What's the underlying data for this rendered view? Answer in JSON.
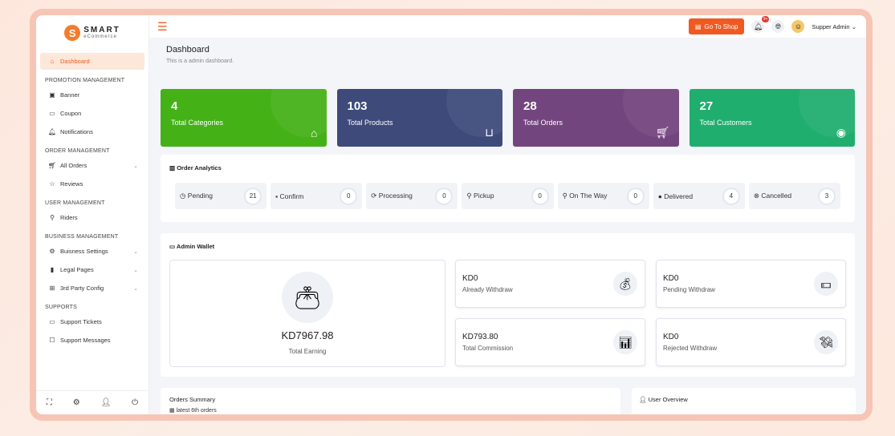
{
  "brand": {
    "name": "SMART",
    "tagline": "eCommerce",
    "mark": "S"
  },
  "sidebar": {
    "dashboard": "Dashboard",
    "sections": [
      {
        "heading": "PROMOTION MANAGEMENT",
        "items": [
          {
            "label": "Banner",
            "icon": "image-icon"
          },
          {
            "label": "Coupon",
            "icon": "ticket-icon"
          },
          {
            "label": "Notifications",
            "icon": "bell-icon"
          }
        ]
      },
      {
        "heading": "ORDER MANAGEMENT",
        "items": [
          {
            "label": "All Orders",
            "icon": "cart-icon"
          },
          {
            "label": "Reviews",
            "icon": "star-icon"
          }
        ]
      },
      {
        "heading": "USER MANAGEMENT",
        "items": [
          {
            "label": "Riders",
            "icon": "bike-icon"
          }
        ]
      },
      {
        "heading": "BUSINESS MANAGEMENT",
        "items": [
          {
            "label": "Buisness Settings",
            "icon": "gear-icon"
          },
          {
            "label": "Legal Pages",
            "icon": "bookmark-icon"
          },
          {
            "label": "3rd Party Config",
            "icon": "sitemap-icon"
          }
        ]
      },
      {
        "heading": "SUPPORTS",
        "items": [
          {
            "label": "Support Tickets",
            "icon": "ticket-icon"
          },
          {
            "label": "Support Messages",
            "icon": "chat-icon"
          }
        ]
      }
    ]
  },
  "topbar": {
    "shop_button": "Go To Shop",
    "notif_badge": "9+",
    "user": "Supper Admin"
  },
  "header": {
    "title": "Dashboard",
    "subtitle": "This is a admin dashboard."
  },
  "stats": [
    {
      "value": "4",
      "label": "Total Categories"
    },
    {
      "value": "103",
      "label": "Total Products"
    },
    {
      "value": "28",
      "label": "Total Orders"
    },
    {
      "value": "27",
      "label": "Total Customers"
    }
  ],
  "analytics": {
    "title": "Order Analytics",
    "items": [
      {
        "label": "Pending",
        "count": "21"
      },
      {
        "label": "Confirm",
        "count": "0"
      },
      {
        "label": "Processing",
        "count": "0"
      },
      {
        "label": "Pickup",
        "count": "0"
      },
      {
        "label": "On The Way",
        "count": "0"
      },
      {
        "label": "Delivered",
        "count": "4"
      },
      {
        "label": "Cancelled",
        "count": "3"
      }
    ]
  },
  "wallet": {
    "title": "Admin Wallet",
    "total_earning": "KD7967.98",
    "total_earning_label": "Total Earning",
    "cards": [
      {
        "value": "KD0",
        "label": "Already Withdraw"
      },
      {
        "value": "KD0",
        "label": "Pending Withdraw"
      },
      {
        "value": "KD793.80",
        "label": "Total Commission"
      },
      {
        "value": "KD0",
        "label": "Rejected Withdraw"
      }
    ]
  },
  "orders_summary": {
    "title": "Orders Summary",
    "subtitle": "latest 6th orders"
  },
  "user_overview": {
    "title": "User Overview"
  },
  "colors": {
    "accent": "#f05a22",
    "card1": "#44b117",
    "card2": "#3d4a7a",
    "card3": "#73457f",
    "card4": "#1fae6e"
  }
}
